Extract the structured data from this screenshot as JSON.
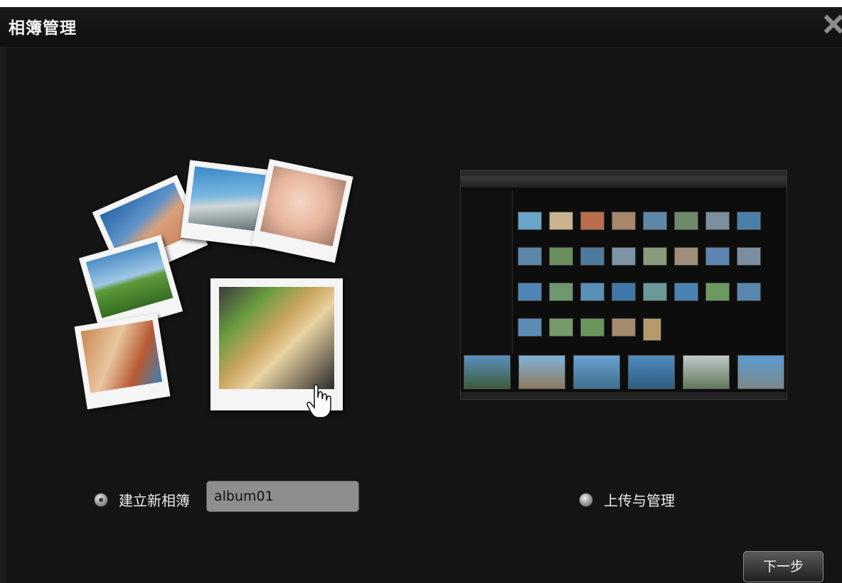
{
  "dialog": {
    "title": "相簿管理",
    "close_icon": "close-icon"
  },
  "options": {
    "create_album": {
      "label": "建立新相簿",
      "selected": true
    },
    "album_name": {
      "value": "album01"
    },
    "upload_manage": {
      "label": "上传与管理",
      "selected": false
    }
  },
  "buttons": {
    "next": "下一步"
  }
}
